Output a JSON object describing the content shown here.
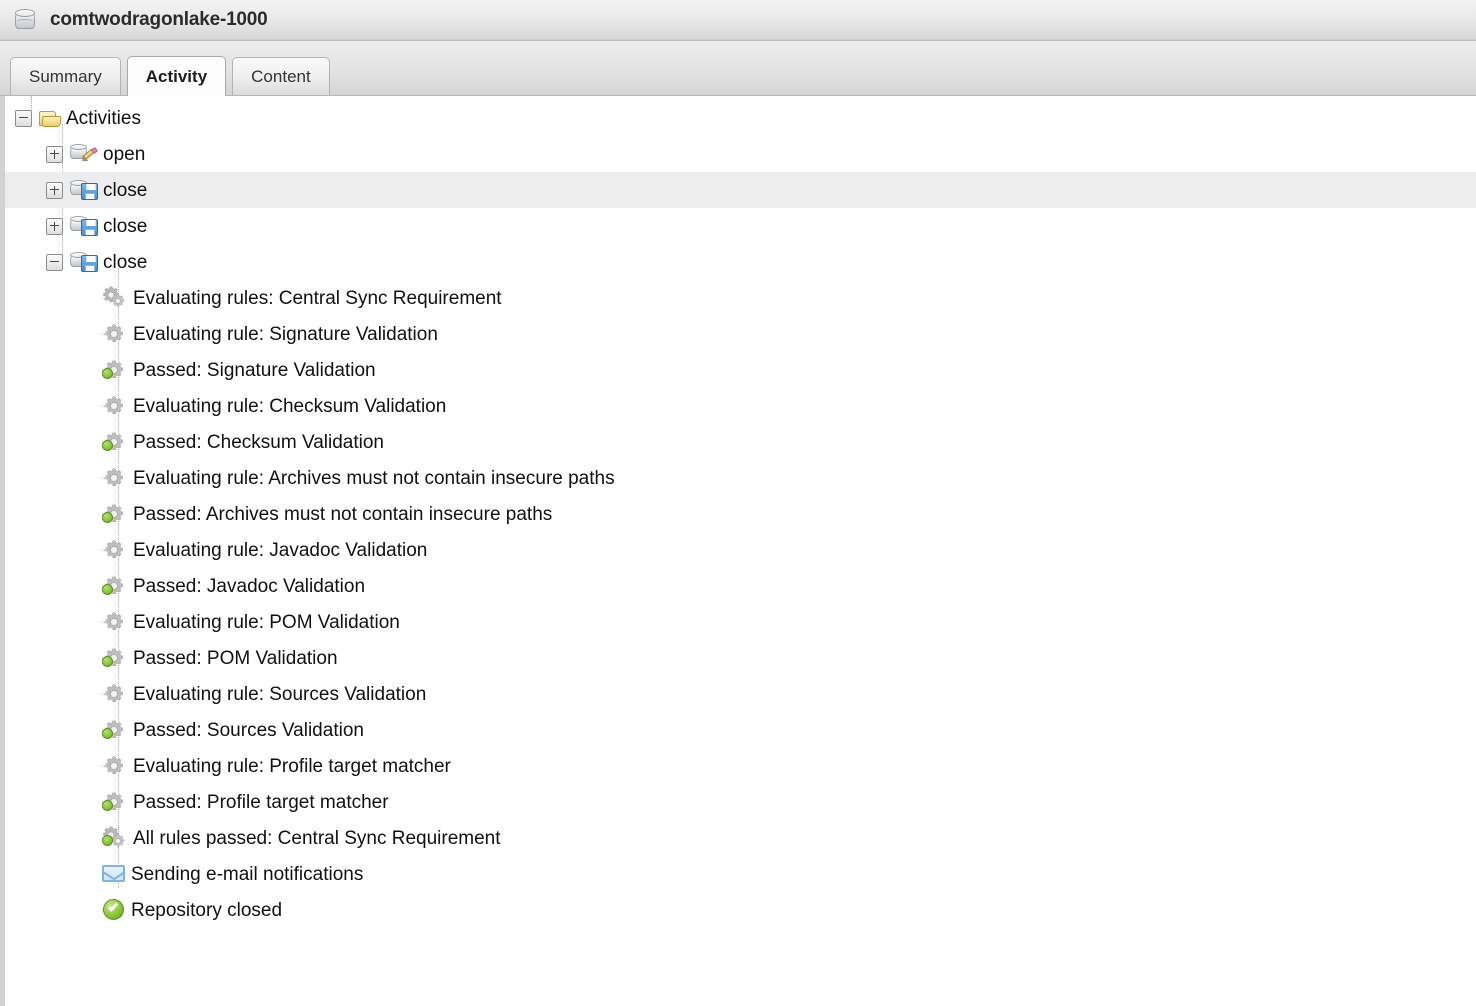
{
  "window": {
    "title": "comtwodragonlake-1000",
    "title_icon": "database-icon"
  },
  "tabs": [
    {
      "label": "Summary",
      "selected": false
    },
    {
      "label": "Activity",
      "selected": true
    },
    {
      "label": "Content",
      "selected": false
    }
  ],
  "tree": {
    "root": {
      "label": "Activities",
      "icon": "folder-open-icon",
      "expander": "minus"
    },
    "nodes": [
      {
        "label": "open",
        "icon": "repository-edit-icon",
        "expander": "plus",
        "highlight": false
      },
      {
        "label": "close",
        "icon": "repository-save-icon",
        "expander": "plus",
        "highlight": true
      },
      {
        "label": "close",
        "icon": "repository-save-icon",
        "expander": "plus",
        "highlight": false
      },
      {
        "label": "close",
        "icon": "repository-save-icon",
        "expander": "minus",
        "highlight": false
      }
    ],
    "events": [
      {
        "label": "Evaluating rules: Central Sync Requirement",
        "icon": "double-gear-icon"
      },
      {
        "label": "Evaluating rule: Signature Validation",
        "icon": "gear-icon"
      },
      {
        "label": "Passed: Signature Validation",
        "icon": "gear-pass-icon"
      },
      {
        "label": "Evaluating rule: Checksum Validation",
        "icon": "gear-icon"
      },
      {
        "label": "Passed: Checksum Validation",
        "icon": "gear-pass-icon"
      },
      {
        "label": "Evaluating rule: Archives must not contain insecure paths",
        "icon": "gear-icon"
      },
      {
        "label": "Passed: Archives must not contain insecure paths",
        "icon": "gear-pass-icon"
      },
      {
        "label": "Evaluating rule: Javadoc Validation",
        "icon": "gear-icon"
      },
      {
        "label": "Passed: Javadoc Validation",
        "icon": "gear-pass-icon"
      },
      {
        "label": "Evaluating rule: POM Validation",
        "icon": "gear-icon"
      },
      {
        "label": "Passed: POM Validation",
        "icon": "gear-pass-icon"
      },
      {
        "label": "Evaluating rule: Sources Validation",
        "icon": "gear-icon"
      },
      {
        "label": "Passed: Sources Validation",
        "icon": "gear-pass-icon"
      },
      {
        "label": "Evaluating rule: Profile target matcher",
        "icon": "gear-icon"
      },
      {
        "label": "Passed: Profile target matcher",
        "icon": "gear-pass-icon"
      },
      {
        "label": "All rules passed: Central Sync Requirement",
        "icon": "double-gear-pass-icon"
      },
      {
        "label": "Sending e-mail notifications",
        "icon": "envelope-icon"
      },
      {
        "label": "Repository closed",
        "icon": "check-circle-icon"
      }
    ]
  },
  "colors": {
    "highlight_row": "#ededed",
    "accent_green": "#8cc63f",
    "accent_blue": "#4a8fd0",
    "folder_yellow": "#e5cf6d"
  }
}
